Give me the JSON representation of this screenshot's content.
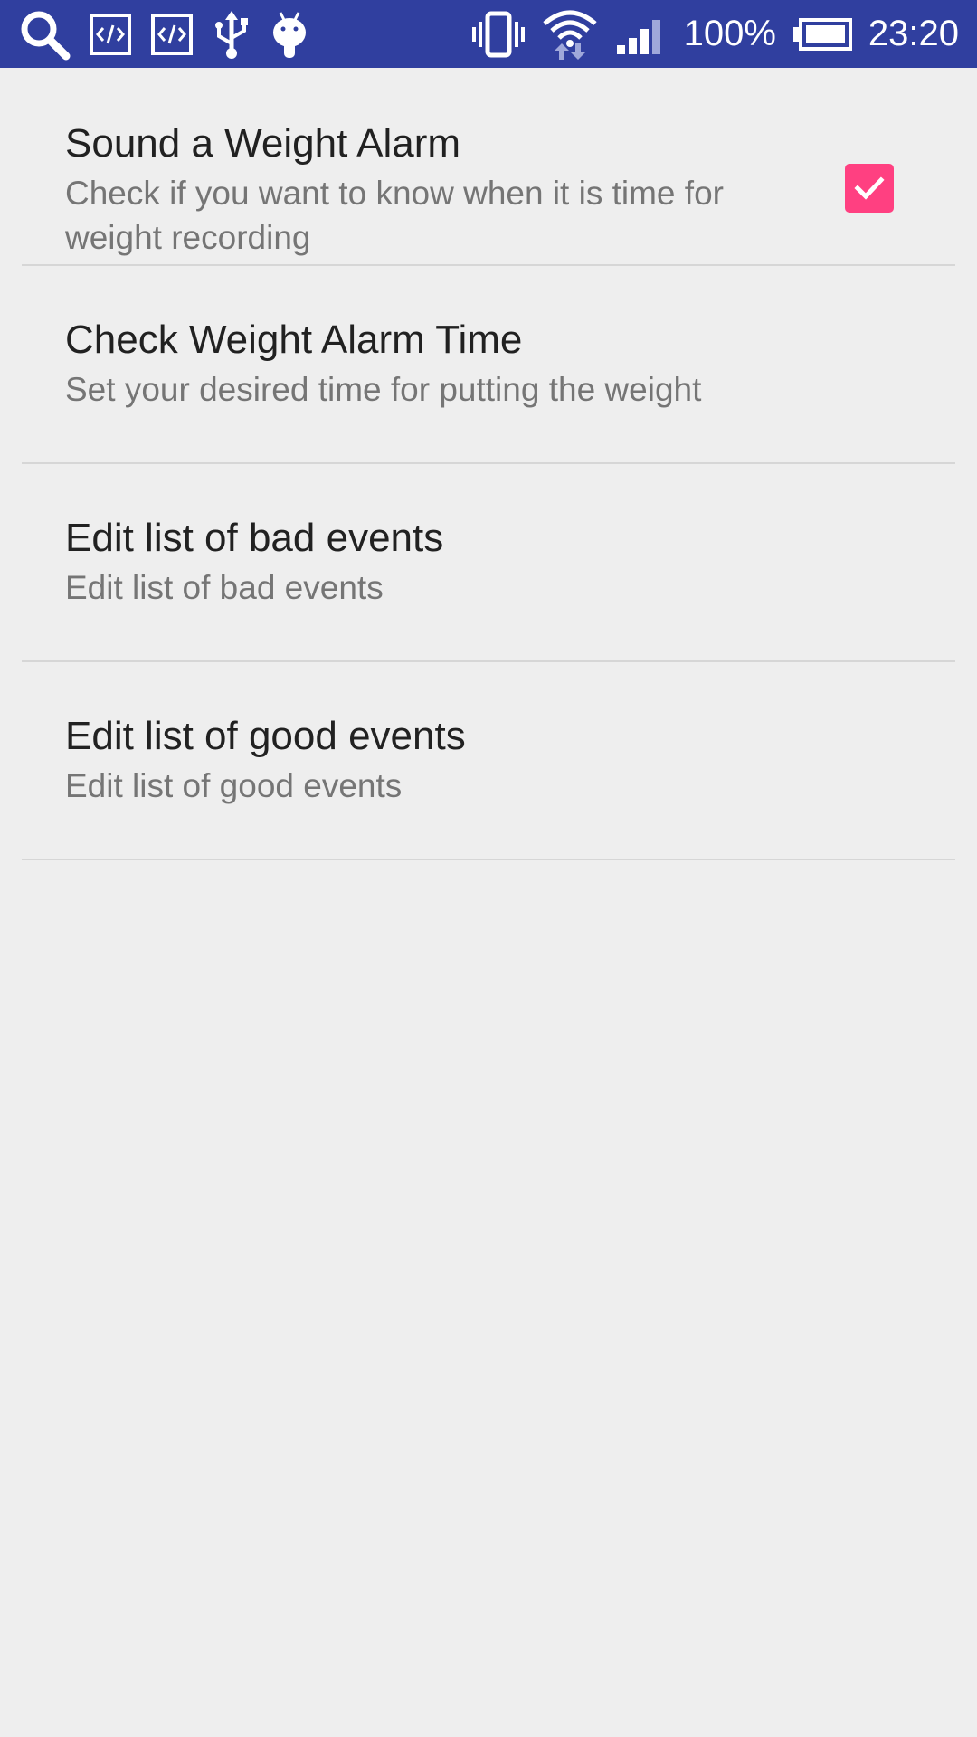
{
  "status_bar": {
    "battery_percent": "100%",
    "time": "23:20",
    "background_color": "#303f9f",
    "left_icons": [
      "search-icon",
      "code-icon",
      "code-icon",
      "usb-icon",
      "android-icon"
    ],
    "right_icons": [
      "vibrate-icon",
      "wifi-icon",
      "signal-icon",
      "battery-icon"
    ]
  },
  "preferences": [
    {
      "title": "Sound a Weight Alarm",
      "summary": "Check if you want to know when it is time for weight recording",
      "checkbox": {
        "checked": true,
        "color": "#ff4081"
      }
    },
    {
      "title": "Check Weight Alarm Time",
      "summary": "Set your desired time for putting the weight"
    },
    {
      "title": "Edit list of bad events",
      "summary": "Edit list of bad events"
    },
    {
      "title": "Edit list of good events",
      "summary": "Edit list of good events"
    }
  ]
}
